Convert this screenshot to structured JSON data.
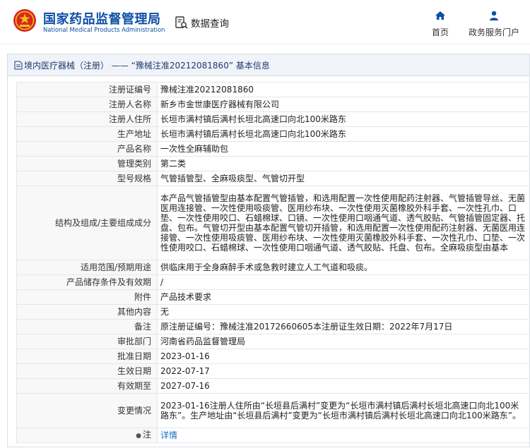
{
  "header": {
    "org_name_cn": "国家药品监督管理局",
    "org_name_en": "National Medical Products Administration",
    "query_label": "数据查询",
    "nav": [
      {
        "label": "首页",
        "icon": "home-icon"
      },
      {
        "label": "政务服务门户",
        "icon": "user-icon"
      }
    ],
    "colors": {
      "brand": "#0d4ea6",
      "accent_red": "#d7281f",
      "gold": "#f2c21b",
      "link": "#1a6ec5"
    }
  },
  "panel": {
    "title": "境内医疗器械（注册） —— “豫械注准20212081860” 基本信息"
  },
  "details": [
    {
      "key": "注册证编号",
      "value": "豫械注准20212081860"
    },
    {
      "key": "注册人名称",
      "value": "新乡市金世康医疗器械有限公司"
    },
    {
      "key": "注册人住所",
      "value": "长垣市满村镇后满村长垣北高速口向北100米路东"
    },
    {
      "key": "生产地址",
      "value": "长垣市满村镇后满村长垣北高速口向北100米路东"
    },
    {
      "key": "产品名称",
      "value": "一次性全麻辅助包"
    },
    {
      "key": "管理类别",
      "value": "第二类"
    },
    {
      "key": "型号规格",
      "value": "气管插管型、全麻吸痰型、气管切开型"
    },
    {
      "key": "结构及组成/主要组成成分",
      "value": "本产品气管插管型由基本配置气管插管，和选用配置一次性使用配药注射器、气管插管导丝、无菌医用连接管、一次性使用吸痰管、医用纱布块、一次性使用灭菌橡胶外科手套、一次性孔巾、口垫、一次性使用咬口、石蜡棉球、口镜、一次性使用口咽通气道、透气胶贴、气管插管固定器、托盘、包布。气管切开型由基本配置气管切开插管，和选用配置一次性使用配药注射器、无菌医用连接管、一次性使用吸痰管、医用纱布块、一次性使用灭菌橡胶外科手套、一次性孔巾、口垫、一次性使用咬口、石蜡棉球、一次性使用口咽通气道、透气胶贴、托盘、包布。全麻吸痰型由基本"
    },
    {
      "key": "适用范围/预期用途",
      "value": "供临床用于全身麻醉手术或急救时建立人工气道和吸痰。"
    },
    {
      "key": "产品储存条件及有效期",
      "value": "/"
    },
    {
      "key": "附件",
      "value": "产品技术要求"
    },
    {
      "key": "其他内容",
      "value": "无"
    },
    {
      "key": "备注",
      "value": "原注册证编号：豫械注准20172660605本注册证生效日期：2022年7月17日"
    },
    {
      "key": "审批部门",
      "value": "河南省药品监督管理局"
    },
    {
      "key": "批准日期",
      "value": "2023-01-16"
    },
    {
      "key": "生效日期",
      "value": "2022-07-17"
    },
    {
      "key": "有效期至",
      "value": "2027-07-16"
    },
    {
      "key": "变更情况",
      "value": "2023-01-16注册人住所由“长垣县后满村”变更为“长垣市满村镇后满村长垣北高速口向北100米路东”。生产地址由“长垣县后满村”变更为“长垣市满村镇后满村长垣北高速口向北100米路东”。"
    }
  ],
  "note_row": {
    "key": "注",
    "icon": "pushpin-icon",
    "link": "详情"
  }
}
